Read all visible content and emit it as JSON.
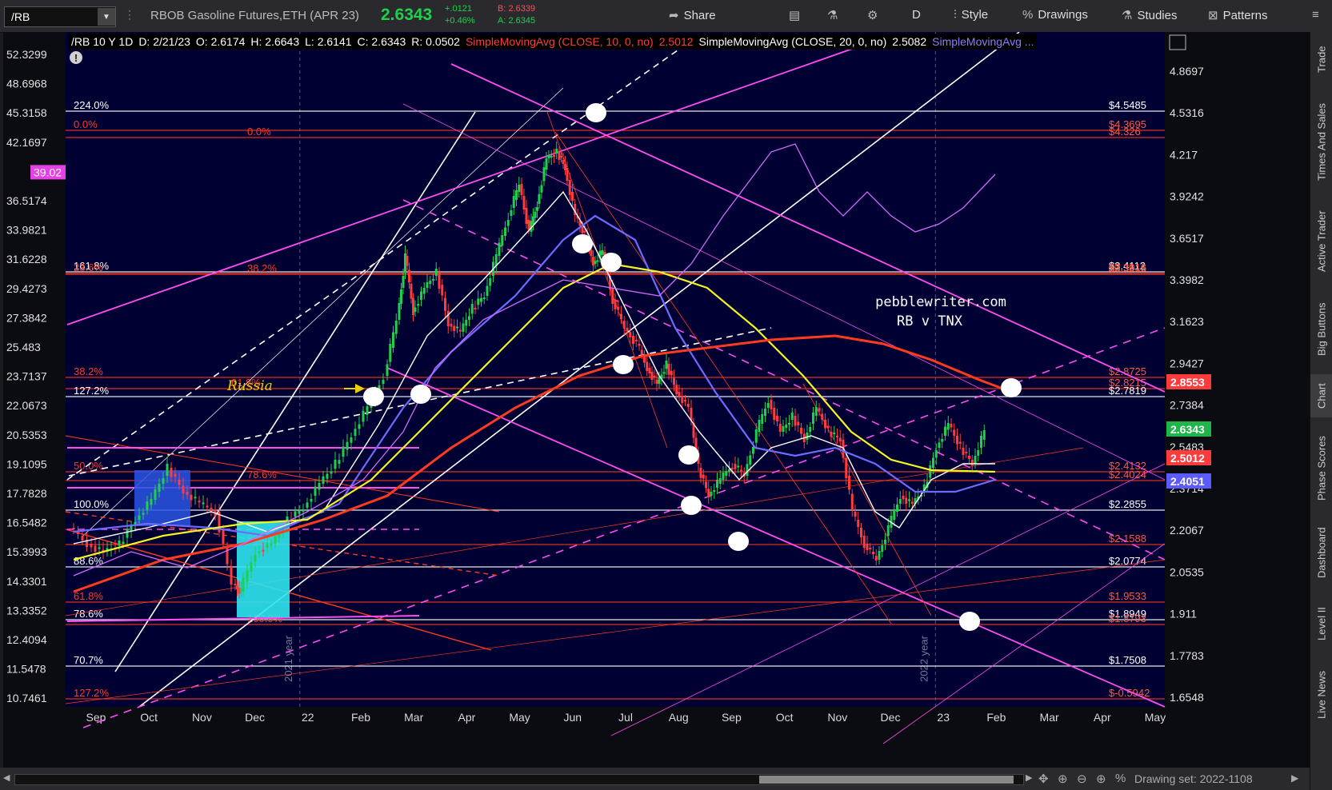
{
  "toolbar": {
    "symbol": "/RB",
    "instrument": "RBOB Gasoline Futures,ETH (APR 23)",
    "last": "2.6343",
    "net_change": "+.0121",
    "net_change_pct": "+0.46%",
    "bid": "B: 2.6339",
    "ask": "A: 2.6345",
    "share": "Share",
    "d": "D",
    "style": "Style",
    "drawings": "Drawings",
    "studies": "Studies",
    "patterns": "Patterns"
  },
  "info": {
    "symbol_period": "/RB 10 Y 1D",
    "date": "D: 2/21/23",
    "open": "O: 2.6174",
    "high": "H: 2.6643",
    "low": "L: 2.6141",
    "close": "C: 2.6343",
    "range": "R: 0.0502",
    "sma10": "SimpleMovingAvg (CLOSE, 10, 0, no)",
    "sma10_val": "2.5012",
    "sma20": "SimpleMovingAvg (CLOSE, 20, 0, no)",
    "sma20_val": "2.5082",
    "sma_more": "SimpleMovingAvg ..."
  },
  "sidebar": {
    "tabs": [
      "Trade",
      "Times And Sales",
      "Active Trader",
      "Big Buttons",
      "Chart",
      "Phase Scores",
      "Dashboard",
      "Level II",
      "Live News"
    ],
    "active": "Chart"
  },
  "bottom": {
    "drawing_set": "Drawing set: 2022-1108"
  },
  "chart_data": {
    "type": "candlestick",
    "title": "RBOB Gasoline Futures,ETH (APR 23)",
    "annotations": [
      "pebblewriter.com",
      "RB v TNX",
      "Russia"
    ],
    "colors": {
      "background": "#000033",
      "up": "#1fd14a",
      "down": "#ff3b3b",
      "sma10": "#ffffff",
      "sma50": "#6c6cff",
      "sma100": "#f4f422",
      "sma200": "#ff3b1f",
      "tnx": "#d26bff",
      "channel": "#ff4df0"
    },
    "x_ticks": [
      "Sep",
      "Oct",
      "Nov",
      "Dec",
      "22",
      "Feb",
      "Mar",
      "Apr",
      "May",
      "Jun",
      "Jul",
      "Aug",
      "Sep",
      "Oct",
      "Nov",
      "Dec",
      "23",
      "Feb",
      "Mar",
      "Apr",
      "May"
    ],
    "year_labels": [
      "2021 year",
      "2022 year"
    ],
    "y_right_ticks": [
      "4.8697",
      "4.5316",
      "4.217",
      "3.9242",
      "3.6517",
      "3.3982",
      "3.1623",
      "2.9427",
      "2.7384",
      "2.5483",
      "2.3714",
      "2.2067",
      "2.0535",
      "1.911",
      "1.7783",
      "1.6548"
    ],
    "y_left_ticks": [
      "52.3299",
      "48.6968",
      "45.3158",
      "42.1697",
      "39.02",
      "36.5174",
      "33.9821",
      "31.6228",
      "29.4273",
      "27.3842",
      "25.483",
      "23.7137",
      "22.0673",
      "20.5353",
      "19.1095",
      "17.7828",
      "16.5482",
      "15.3993",
      "14.3301",
      "13.3352",
      "12.4094",
      "11.5478",
      "10.7461"
    ],
    "left_current": "39.02",
    "price_labels": [
      {
        "text": "2.8553",
        "color": "#ff3b3b"
      },
      {
        "text": "2.6343",
        "color": "#1fb54a"
      },
      {
        "text": "2.5012",
        "color": "#ff3b3b"
      },
      {
        "text": "2.4051",
        "color": "#5b5bff"
      }
    ],
    "fib_levels": [
      {
        "label": "224.0%",
        "value": "$4.5485",
        "color": "#ffffff"
      },
      {
        "label": "0.0%",
        "value": "$4.3695",
        "color": "#ff3b1f"
      },
      {
        "label": "0.0%",
        "value": "$4.326",
        "color": "#ff3b1f"
      },
      {
        "label": "161.8%",
        "value": "$3.4112",
        "color": "#ffffff"
      },
      {
        "label": "23.6%",
        "value": "$3.3916",
        "color": "#ff3b1f"
      },
      {
        "label": "38.2%",
        "value": "$3.3916",
        "color": "#ff3b1f"
      },
      {
        "label": "38.2%",
        "value": "$2.8725",
        "color": "#ff3b1f"
      },
      {
        "label": "61.8%",
        "value": "$2.8215",
        "color": "#ff3b1f"
      },
      {
        "label": "127.2%",
        "value": "$2.7819",
        "color": "#ffffff"
      },
      {
        "label": "50.0%",
        "value": "$2.4132",
        "color": "#ff3b1f"
      },
      {
        "label": "78.6%",
        "value": "$2.4024",
        "color": "#ff3b1f"
      },
      {
        "label": "100.0%",
        "value": "$2.2855",
        "color": "#ffffff"
      },
      {
        "label": "88.6%",
        "value": "$2.1588",
        "color": "#ff3b1f"
      },
      {
        "label": "88.6%",
        "value": "$2.0774",
        "color": "#ffffff"
      },
      {
        "label": "61.8%",
        "value": "$1.9533",
        "color": "#ff3b1f"
      },
      {
        "label": "78.6%",
        "value": "$1.8949",
        "color": "#ffffff"
      },
      {
        "label": "100.0%",
        "value": "$1.8793",
        "color": "#ff3b1f"
      },
      {
        "label": "70.7%",
        "value": "$1.7508",
        "color": "#ffffff"
      },
      {
        "label": "127.2%",
        "value": "$-0.5942",
        "color": "#ff3b1f"
      }
    ]
  }
}
